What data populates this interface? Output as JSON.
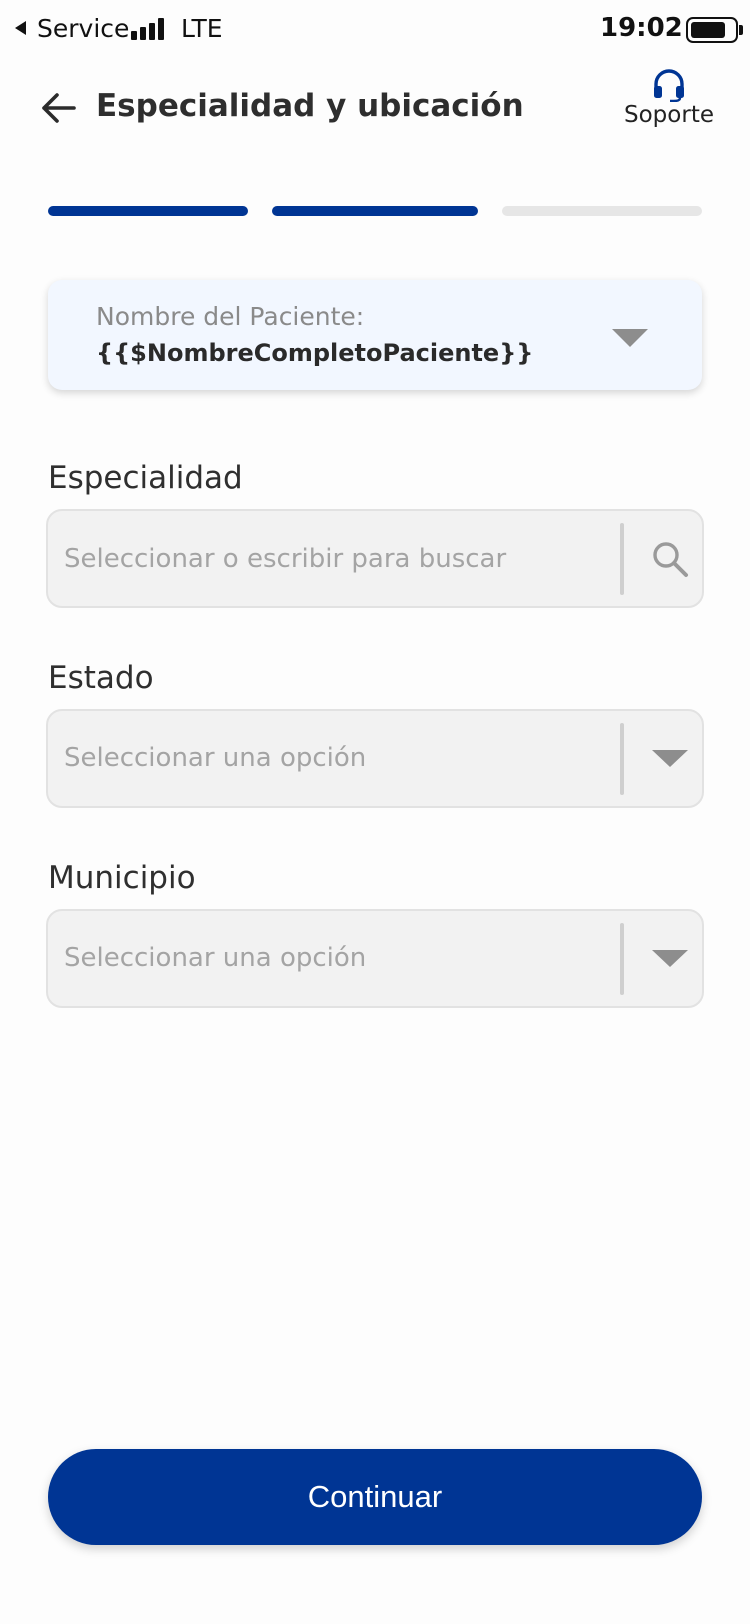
{
  "status_bar": {
    "carrier": "Service",
    "network": "LTE",
    "time": "19:02"
  },
  "header": {
    "title": "Especialidad y ubicación",
    "support_label": "Soporte"
  },
  "progress": {
    "total_steps": 3,
    "completed_steps": 2,
    "active_color": "#003594",
    "inactive_color": "#e6e6e6"
  },
  "patient_selector": {
    "label": "Nombre del Paciente:",
    "value": "{{$NombreCompletoPaciente}}"
  },
  "form": {
    "especialidad": {
      "label": "Especialidad",
      "placeholder": "Seleccionar o escribir para buscar"
    },
    "estado": {
      "label": "Estado",
      "value": "Seleccionar una opción"
    },
    "municipio": {
      "label": "Municipio",
      "value": "Seleccionar una opción"
    }
  },
  "continue_button": {
    "label": "Continuar"
  },
  "icons": {
    "back": "arrow-left-icon",
    "support": "headset-icon",
    "search": "search-icon",
    "dropdown": "chevron-down-icon"
  },
  "colors": {
    "brand": "#003594",
    "card_background": "#f2f7ff",
    "field_background": "#f2f2f2"
  }
}
